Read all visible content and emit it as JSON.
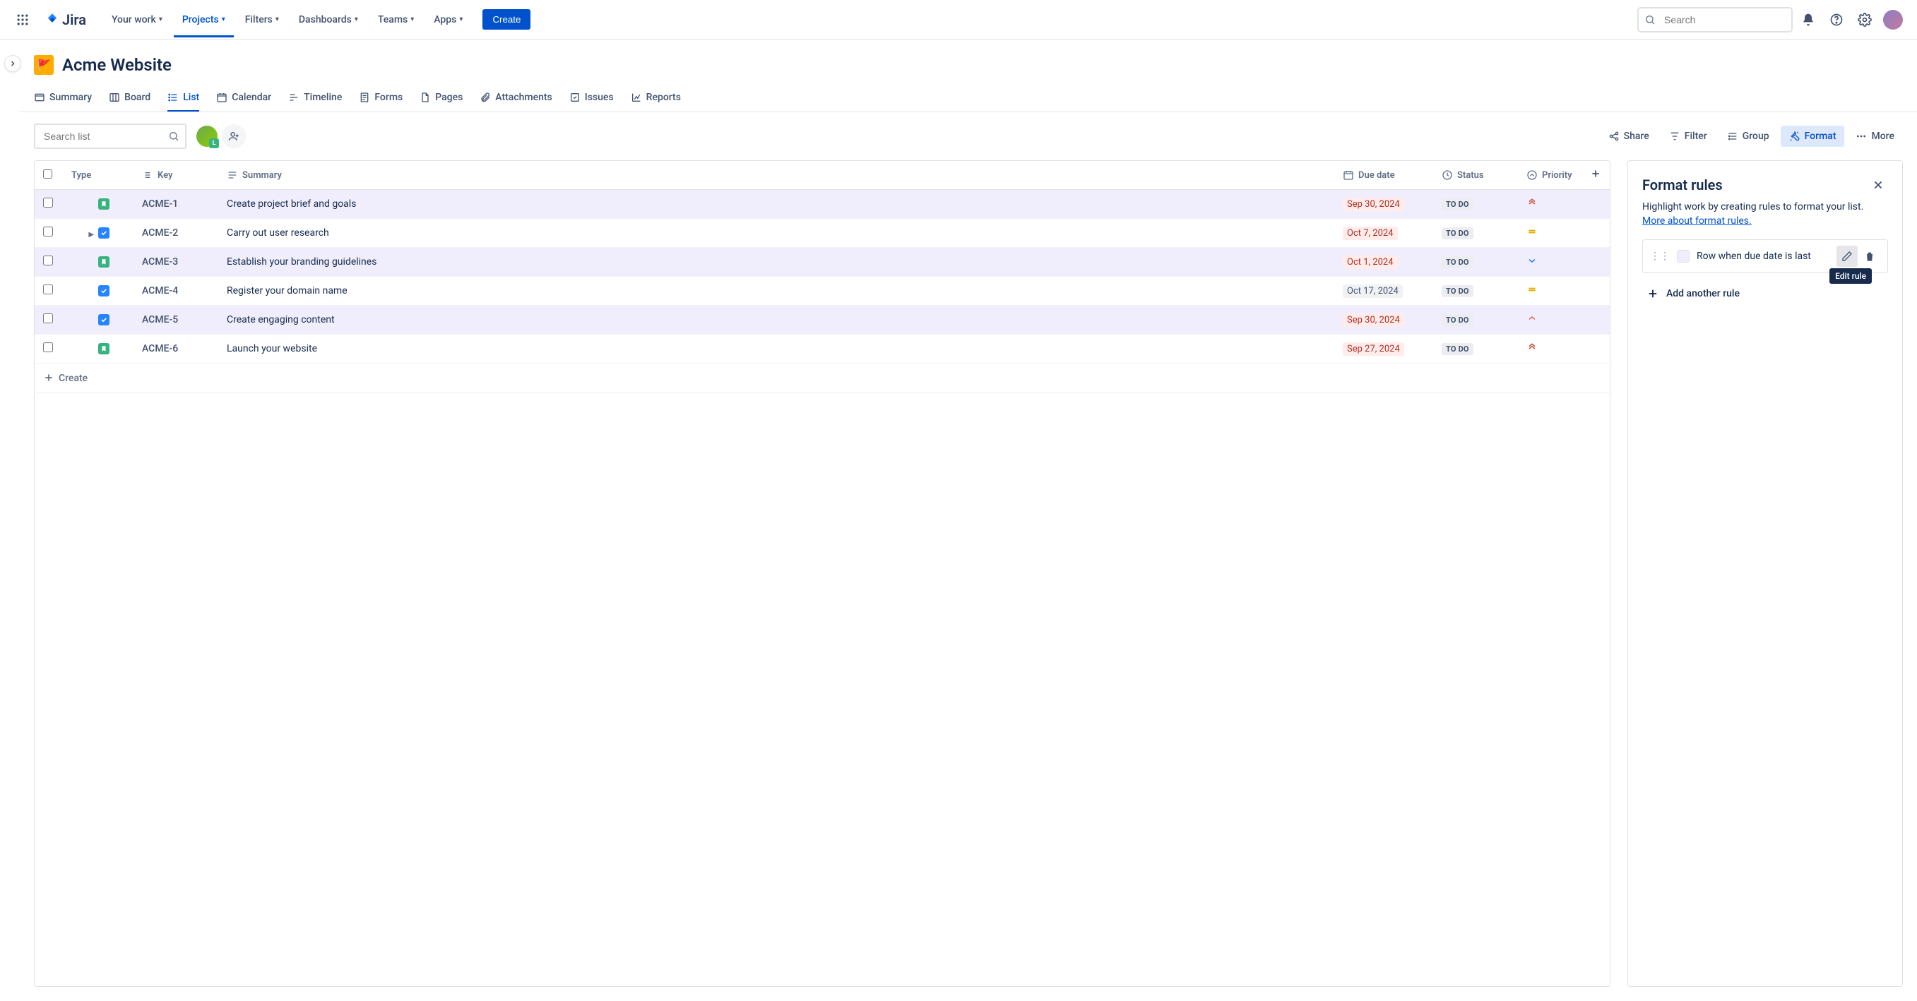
{
  "product": "Jira",
  "topnav": {
    "items": [
      {
        "label": "Your work"
      },
      {
        "label": "Projects"
      },
      {
        "label": "Filters"
      },
      {
        "label": "Dashboards"
      },
      {
        "label": "Teams"
      },
      {
        "label": "Apps"
      }
    ],
    "create_label": "Create",
    "search_placeholder": "Search"
  },
  "project": {
    "name": "Acme Website"
  },
  "tabs": [
    {
      "label": "Summary"
    },
    {
      "label": "Board"
    },
    {
      "label": "List"
    },
    {
      "label": "Calendar"
    },
    {
      "label": "Timeline"
    },
    {
      "label": "Forms"
    },
    {
      "label": "Pages"
    },
    {
      "label": "Attachments"
    },
    {
      "label": "Issues"
    },
    {
      "label": "Reports"
    }
  ],
  "list_search_placeholder": "Search list",
  "toolbar": {
    "share": "Share",
    "filter": "Filter",
    "group": "Group",
    "format": "Format",
    "more": "More"
  },
  "columns": {
    "type": "Type",
    "key": "Key",
    "summary": "Summary",
    "due": "Due date",
    "status": "Status",
    "priority": "Priority"
  },
  "rows": [
    {
      "type": "story",
      "key": "ACME-1",
      "summary": "Create project brief and goals",
      "due": "Sep 30, 2024",
      "due_state": "overdue",
      "status": "TO DO",
      "priority": "highest",
      "hl": true,
      "expandable": false
    },
    {
      "type": "task",
      "key": "ACME-2",
      "summary": "Carry out user research",
      "due": "Oct 7, 2024",
      "due_state": "overdue",
      "status": "TO DO",
      "priority": "medium",
      "hl": false,
      "expandable": true
    },
    {
      "type": "story",
      "key": "ACME-3",
      "summary": "Establish your branding guidelines",
      "due": "Oct 1, 2024",
      "due_state": "overdue",
      "status": "TO DO",
      "priority": "low",
      "hl": true,
      "expandable": false
    },
    {
      "type": "task",
      "key": "ACME-4",
      "summary": "Register your domain name",
      "due": "Oct 17, 2024",
      "due_state": "normal",
      "status": "TO DO",
      "priority": "medium",
      "hl": false,
      "expandable": false
    },
    {
      "type": "task",
      "key": "ACME-5",
      "summary": "Create engaging content",
      "due": "Sep 30, 2024",
      "due_state": "overdue",
      "status": "TO DO",
      "priority": "high",
      "hl": true,
      "expandable": false
    },
    {
      "type": "story",
      "key": "ACME-6",
      "summary": "Launch your website",
      "due": "Sep 27, 2024",
      "due_state": "overdue",
      "status": "TO DO",
      "priority": "highest",
      "hl": false,
      "expandable": false
    }
  ],
  "create_row_label": "Create",
  "panel": {
    "title": "Format rules",
    "desc_prefix": "Highlight work by creating rules to format your list. ",
    "desc_link": "More about format rules.",
    "rule_text": "Row when due date is last",
    "tooltip": "Edit rule",
    "add_rule": "Add another rule"
  }
}
